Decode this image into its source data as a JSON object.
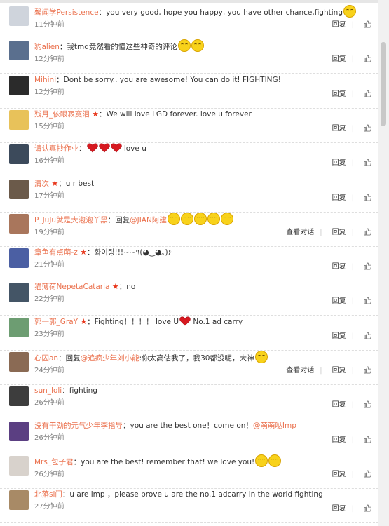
{
  "actions": {
    "reply": "回复",
    "view_conv": "查看对话"
  },
  "comments": [
    {
      "user": "馨闻学Persistence",
      "sep": "：",
      "text": "you very good, hope you happy, you have other chance,fighting",
      "emoji_count": 1,
      "time": "11分钟前",
      "avatar_color": "#cfd4dc"
    },
    {
      "user": "豹alien",
      "sep": "：",
      "text": "我tmd竟然看的懂这些神奇的评论",
      "emoji_count": 2,
      "time": "12分钟前",
      "avatar_color": "#5a6f8e"
    },
    {
      "user": "Mihini",
      "sep": "：",
      "text": "Dont be sorry.. you are awesome! You can do it! FIGHTING!",
      "time": "12分钟前",
      "avatar_color": "#2b2b2b"
    },
    {
      "user": "残月_依眼寂寞泪",
      "sep": "：",
      "text": "We will love LGD forever. love u forever",
      "time": "15分钟前",
      "avatar_color": "#e8c25a",
      "star": "★"
    },
    {
      "user": "请认真抄作业",
      "sep": "：",
      "text": "love u",
      "hearts": 3,
      "time": "16分钟前",
      "avatar_color": "#3c4a5b"
    },
    {
      "user": "清次",
      "sep": "：",
      "text": "u r best",
      "time": "17分钟前",
      "avatar_color": "#6b5a4a",
      "star": "★"
    },
    {
      "user": "P_JuJu就是大泡泡丫黑",
      "sep": "：",
      "text": "回复",
      "mention": "@JIAN阿建",
      "emoji_count": 5,
      "time": "19分钟前",
      "avatar_color": "#a9765c",
      "view_conv": true
    },
    {
      "user": "章鱼有点萌-z",
      "sep": "：",
      "text": "화이팅!!!~~٩(◕‿◕｡)۶",
      "time": "21分钟前",
      "avatar_color": "#4b5fa3",
      "star": "★"
    },
    {
      "user": "猫薄荷NepetaCataria",
      "sep": "：",
      "text": "no",
      "time": "22分钟前",
      "avatar_color": "#445566",
      "star": "★"
    },
    {
      "user": "郭一郭_GraY",
      "sep": "：",
      "text": "Fighting！！！！ love U",
      "text2": "No.1 ad carry",
      "time": "23分钟前",
      "avatar_color": "#6d9d72",
      "star": "★"
    },
    {
      "user": "心囚an",
      "sep": "：",
      "text": "回复",
      "mention": "@追疯少年刘小能",
      "text2": ":你太高估我了，我30都没呢，大神",
      "emoji_count": 1,
      "time": "24分钟前",
      "avatar_color": "#8a6a54",
      "view_conv": true
    },
    {
      "user": "sun_loli",
      "sep": "：",
      "text": "fighting",
      "time": "26分钟前",
      "avatar_color": "#3d3d3d"
    },
    {
      "user": "没有干劲的元气少年李指导",
      "sep": "：",
      "text": "you are the best one！come on！",
      "mention": "@萌萌哒Imp",
      "time": "26分钟前",
      "avatar_color": "#5b3f82"
    },
    {
      "user": "Mrs_包子君",
      "sep": "：",
      "text": "you are the best! remember that! we love you!",
      "emoji_count": 2,
      "time": "26分钟前",
      "avatar_color": "#d8d2cc"
    },
    {
      "user": "北落sl门",
      "sep": "：",
      "text": "u are imp ，please prove u are the no.1 adcarry in the world fighting",
      "time": "27分钟前",
      "avatar_color": "#a88a66"
    }
  ]
}
